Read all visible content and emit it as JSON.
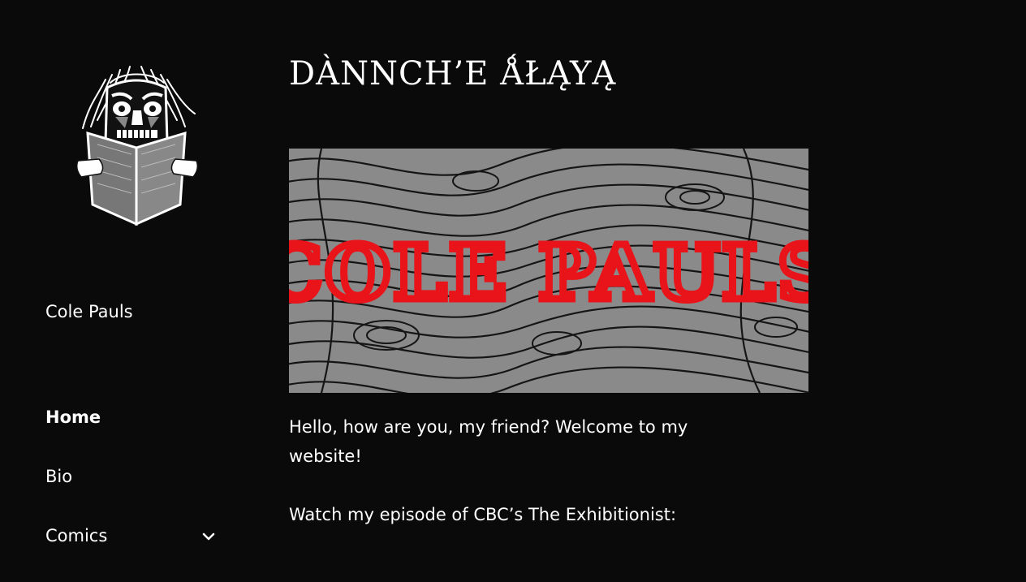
{
  "sidebar": {
    "site_title": "Cole Pauls",
    "nav": [
      {
        "label": "Home",
        "active": true
      },
      {
        "label": "Bio",
        "active": false
      },
      {
        "label": "Comics",
        "active": false,
        "has_submenu": true
      }
    ]
  },
  "main": {
    "page_title": "DÀNNCH’E ǺŁĄYĄ",
    "banner_text": "COLE PAULS",
    "paragraphs": [
      "Hello, how are you, my friend? Welcome to my website!",
      "Watch my episode of CBC’s The Exhibitionist:"
    ]
  },
  "colors": {
    "background": "#0a0a0a",
    "text": "#ffffff",
    "banner_lettering": "#e8141a",
    "banner_base": "#8a8a8a"
  },
  "icons": {
    "logo": "masked-reader-logo",
    "submenu": "chevron-down-icon"
  }
}
